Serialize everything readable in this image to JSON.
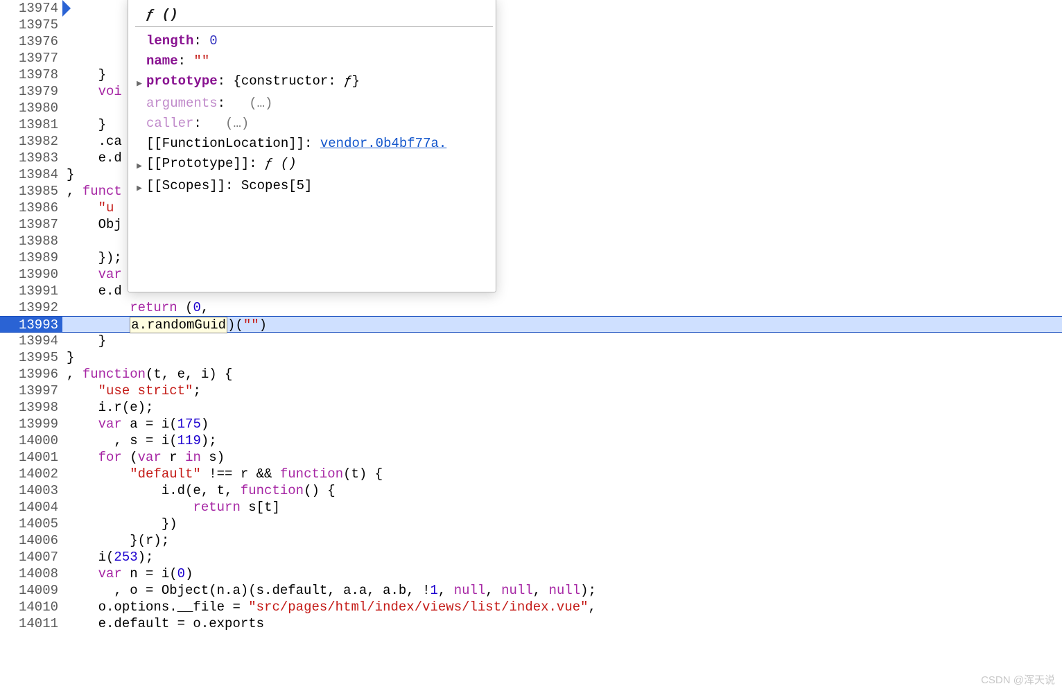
{
  "gutter": {
    "start": 13974,
    "end": 14011,
    "highlighted": 13993
  },
  "highlighted_code": {
    "boxed": "a.randomGuid",
    "after_box": ")(",
    "string_arg": "\"\"",
    "closing": ")"
  },
  "code_lines": {
    "13974": "",
    "13975": "",
    "13976": "",
    "13977": "",
    "13978": "    }",
    "13979": "    voi",
    "13980": "",
    "13981": "    }",
    "13982": "    .ca",
    "13983": "    e.d",
    "13984": "}",
    "13985_pre": ", ",
    "13985_kw": "funct",
    "13986": "    \"u",
    "13987": "    Obj",
    "13988": "",
    "13989": "    });",
    "13990_pre": "    ",
    "13990_kw": "var",
    "13991": "    e.d",
    "13992_pre": "        ",
    "13992_kw": "return",
    "13992_post": " (",
    "13992_num": "0",
    "13992_end": ",",
    "13994": "    }",
    "13995": "}",
    "13996_pre": ", ",
    "13996_kw": "function",
    "13996_post": "(t, e, i) {",
    "13997_pre": "    ",
    "13997_str": "\"use strict\"",
    "13997_post": ";",
    "13998": "    i.r(e);",
    "13999_pre": "    ",
    "13999_kw": "var",
    "13999_post": " a = i(",
    "13999_num": "175",
    "13999_end": ")",
    "14000_pre": "      , s = i(",
    "14000_num": "119",
    "14000_end": ");",
    "14001_pre": "    ",
    "14001_kw1": "for",
    "14001_mid": " (",
    "14001_kw2": "var",
    "14001_post": " r ",
    "14001_kw3": "in",
    "14001_end": " s)",
    "14002_pre": "        ",
    "14002_str": "\"default\"",
    "14002_mid": " !== r && ",
    "14002_kw": "function",
    "14002_end": "(t) {",
    "14003_pre": "            i.d(e, t, ",
    "14003_kw": "function",
    "14003_end": "() {",
    "14004_pre": "                ",
    "14004_kw": "return",
    "14004_end": " s[t]",
    "14005": "            })",
    "14006": "        }(r);",
    "14007_pre": "    i(",
    "14007_num": "253",
    "14007_end": ");",
    "14008_pre": "    ",
    "14008_kw": "var",
    "14008_mid": " n = i(",
    "14008_num": "0",
    "14008_end": ")",
    "14009_pre": "      , o = Object(n.a)(s.default, a.a, a.b, !",
    "14009_num": "1",
    "14009_mid": ", ",
    "14009_kw": "null",
    "14009_mid2": ", ",
    "14009_end": ");",
    "14010_pre": "    o.options.__file = ",
    "14010_str": "\"src/pages/html/index/views/list/index.vue\"",
    "14010_end": ",",
    "14011": "    e.default = o.exports"
  },
  "tooltip": {
    "header": "ƒ ()",
    "rows": [
      {
        "tri": false,
        "prop_style": "bold",
        "prop": "length",
        "colon": ": ",
        "val": "0",
        "val_style": "num"
      },
      {
        "tri": false,
        "prop_style": "bold",
        "prop": "name",
        "colon": ": ",
        "val": "\"\"",
        "val_style": "str"
      },
      {
        "tri": true,
        "prop_style": "bold",
        "prop": "prototype",
        "colon": ": ",
        "val": "{constructor: ƒ}",
        "val_style": "plain-italic-f"
      },
      {
        "tri": false,
        "prop_style": "dim",
        "prop": "arguments",
        "colon": ": ",
        "pad": "  ",
        "val": "(…)",
        "val_style": "dim"
      },
      {
        "tri": false,
        "prop_style": "dim",
        "prop": "caller",
        "colon": ":  ",
        "pad": " ",
        "val": "(…)",
        "val_style": "dim"
      },
      {
        "tri": false,
        "prop_style": "plain",
        "prop": "[[FunctionLocation]]",
        "colon": ": ",
        "val": "vendor.0b4bf77a.",
        "val_style": "link"
      },
      {
        "tri": true,
        "prop_style": "plain",
        "prop": "[[Prototype]]",
        "colon": ": ",
        "val": "ƒ ()",
        "val_style": "italic"
      },
      {
        "tri": true,
        "prop_style": "plain",
        "prop": "[[Scopes]]",
        "colon": ": ",
        "val": "Scopes[5]",
        "val_style": "plain"
      }
    ]
  },
  "watermark": "CSDN @浑天说"
}
